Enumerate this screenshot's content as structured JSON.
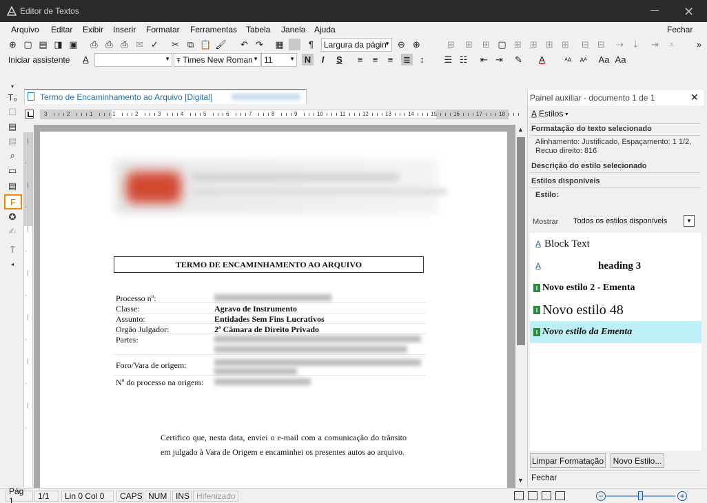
{
  "window": {
    "title": "Editor de Textos"
  },
  "menu": {
    "items": [
      "Arquivo",
      "Editar",
      "Exibir",
      "Inserir",
      "Formatar",
      "Ferramentas",
      "Tabela",
      "Janela",
      "Ajuda"
    ],
    "close_label": "Fechar"
  },
  "toolbar": {
    "zoom_value": "Largura da págin",
    "assistant_label": "Iniciar assistente",
    "style_value": "",
    "font_value": "Times New Roman",
    "size_value": "11"
  },
  "document": {
    "tab_label": "Termo de Encaminhamento ao Arquivo [Digital]",
    "title": "TERMO DE ENCAMINHAMENTO AO ARQUIVO",
    "fields": [
      {
        "label": "Processo nº:",
        "value": ""
      },
      {
        "label": "Classe:",
        "value": "Agravo de Instrumento"
      },
      {
        "label": "Assunto:",
        "value": "Entidades Sem Fins Lucrativos"
      },
      {
        "label": "Orgão Julgador:",
        "value": "2ª Câmara de Direito Privado"
      },
      {
        "label": "Partes:",
        "value": ""
      },
      {
        "label": "Foro/Vara de origem:",
        "value": ""
      },
      {
        "label": "Nº do processo na origem:",
        "value": ""
      }
    ],
    "body": "Certifico que, nesta data, enviei o e-mail com a comunicação do trânsito em julgado à Vara de Origem e encaminhei os presentes autos ao arquivo."
  },
  "panel": {
    "title": "Painel auxiliar - documento 1 de 1",
    "styles_label": "Estilos",
    "section_format": "Formatação do texto selecionado",
    "format_text": "Alinhamento: Justificado, Espaçamento: 1 1/2, Recuo direito: 816",
    "section_desc": "Descrição do estilo selecionado",
    "section_available": "Estilos disponíveis",
    "style_label": "Estilo:",
    "show_label": "Mostrar",
    "show_value": "Todos os estilos disponíveis",
    "styles": [
      "Block Text",
      "heading 3",
      "Novo estilo 2 - Ementa",
      "Novo estilo 48",
      "Novo estilo da Ementa"
    ],
    "clear_button": "Limpar Formatação",
    "new_style_button": "Novo Estilo...",
    "close_label": "Fechar"
  },
  "status": {
    "page": "Pág 1",
    "page_count": "1/1",
    "position": "Lin 0  Col 0",
    "caps": "CAPS",
    "num": "NUM",
    "ins": "INS",
    "hyphenation": "Hifenizado"
  },
  "ruler": {
    "labels": [
      "3",
      "2",
      "1",
      "1",
      "2",
      "3",
      "4",
      "5",
      "6",
      "7",
      "8",
      "9",
      "10",
      "11",
      "12",
      "13",
      "14",
      "15",
      "16",
      "17",
      "18"
    ]
  },
  "colors": {
    "titlebar": "#2b2b2b",
    "accent": "#0078d7",
    "highlight_border": "#f08a00",
    "selected_style": "#bdf0f6"
  }
}
